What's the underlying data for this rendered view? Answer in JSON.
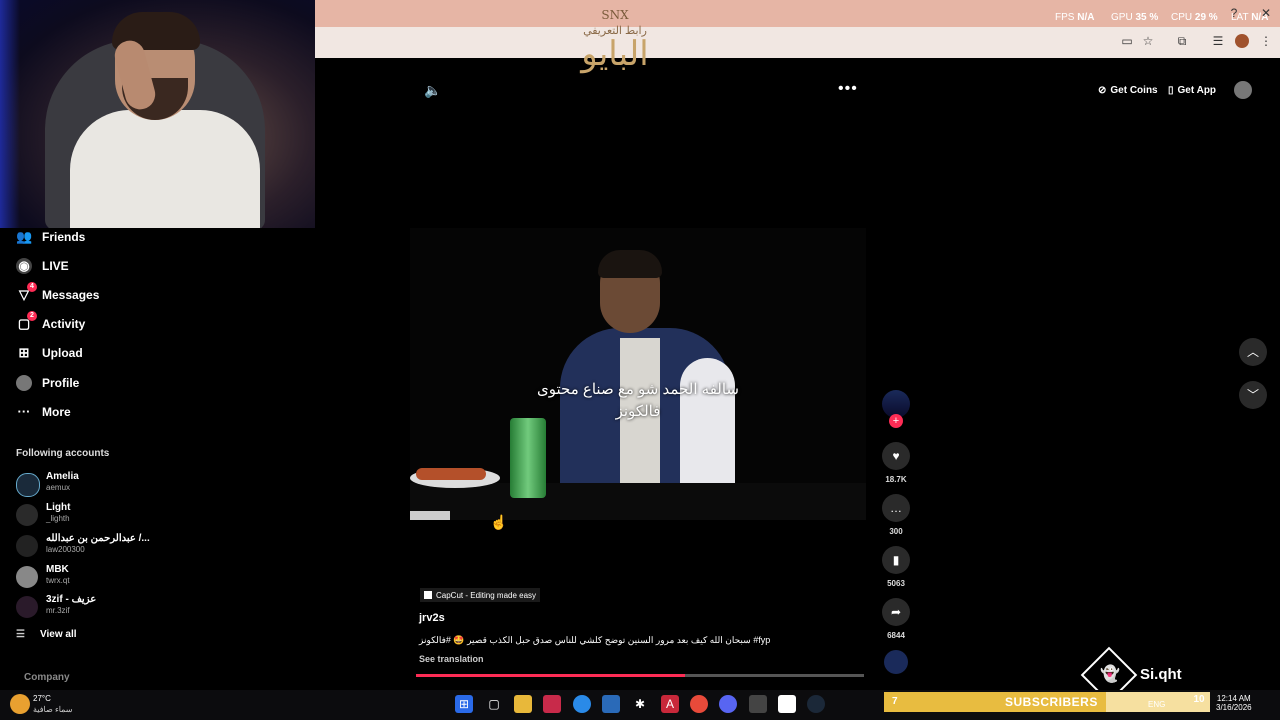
{
  "chrome": {
    "stats": [
      {
        "label": "FPS",
        "value": "N/A"
      },
      {
        "label": "GPU",
        "value": "35 %"
      },
      {
        "label": "CPU",
        "value": "29 %"
      },
      {
        "label": "LAT",
        "value": "N/A"
      }
    ]
  },
  "logo": {
    "line1": "SNX",
    "line2": "رابط التعريفي",
    "line3": "البايو"
  },
  "sidebar": {
    "items": [
      {
        "label": "Friends",
        "icon": "friends-icon"
      },
      {
        "label": "LIVE",
        "icon": "live-icon"
      },
      {
        "label": "Messages",
        "icon": "messages-icon",
        "badge": "4"
      },
      {
        "label": "Activity",
        "icon": "activity-icon",
        "badge": "2"
      },
      {
        "label": "Upload",
        "icon": "upload-icon"
      },
      {
        "label": "Profile",
        "icon": "profile-icon"
      },
      {
        "label": "More",
        "icon": "more-icon"
      }
    ],
    "following_title": "Following accounts",
    "accounts": [
      {
        "name": "Amelia",
        "handle": "aemux"
      },
      {
        "name": "Light",
        "handle": "_lighth"
      },
      {
        "name": "عبدالرحمن بن عبدالله /...",
        "handle": "law200300"
      },
      {
        "name": "MBK",
        "handle": "twrx.qt"
      },
      {
        "name": "3zif - عزيف",
        "handle": "mr.3zif"
      }
    ],
    "view_all": "View all",
    "company": "Company"
  },
  "topbar": {
    "get_coins": "Get Coins",
    "get_app": "Get App"
  },
  "video": {
    "caption_line1": "سالفه الحمد شو مع صناع محتوى",
    "caption_line2": "فالكونز",
    "progress": 0.6
  },
  "actions": {
    "likes": "18.7K",
    "comments": "300",
    "saves": "5063",
    "shares": "6844"
  },
  "info": {
    "capcut": "CapCut - Editing made easy",
    "username": "jrv2s",
    "description": "سبحان الله كيف بعد مرور السنين توضح كلشي للناس صدق حبل الكذب قصير 🤩 #فالكونز #fyp",
    "see_translation": "See translation"
  },
  "overlay": {
    "snap_name": "Si.qht",
    "subscribers_count": "7",
    "subscribers_label": "SUBSCRIBERS",
    "subscribers_progress": 0.68
  },
  "taskbar": {
    "temp": "27°C",
    "weather": "سماء صافية",
    "lang": "ENG",
    "notif": "10",
    "time": "12:14 AM",
    "date": "3/16/2026"
  }
}
